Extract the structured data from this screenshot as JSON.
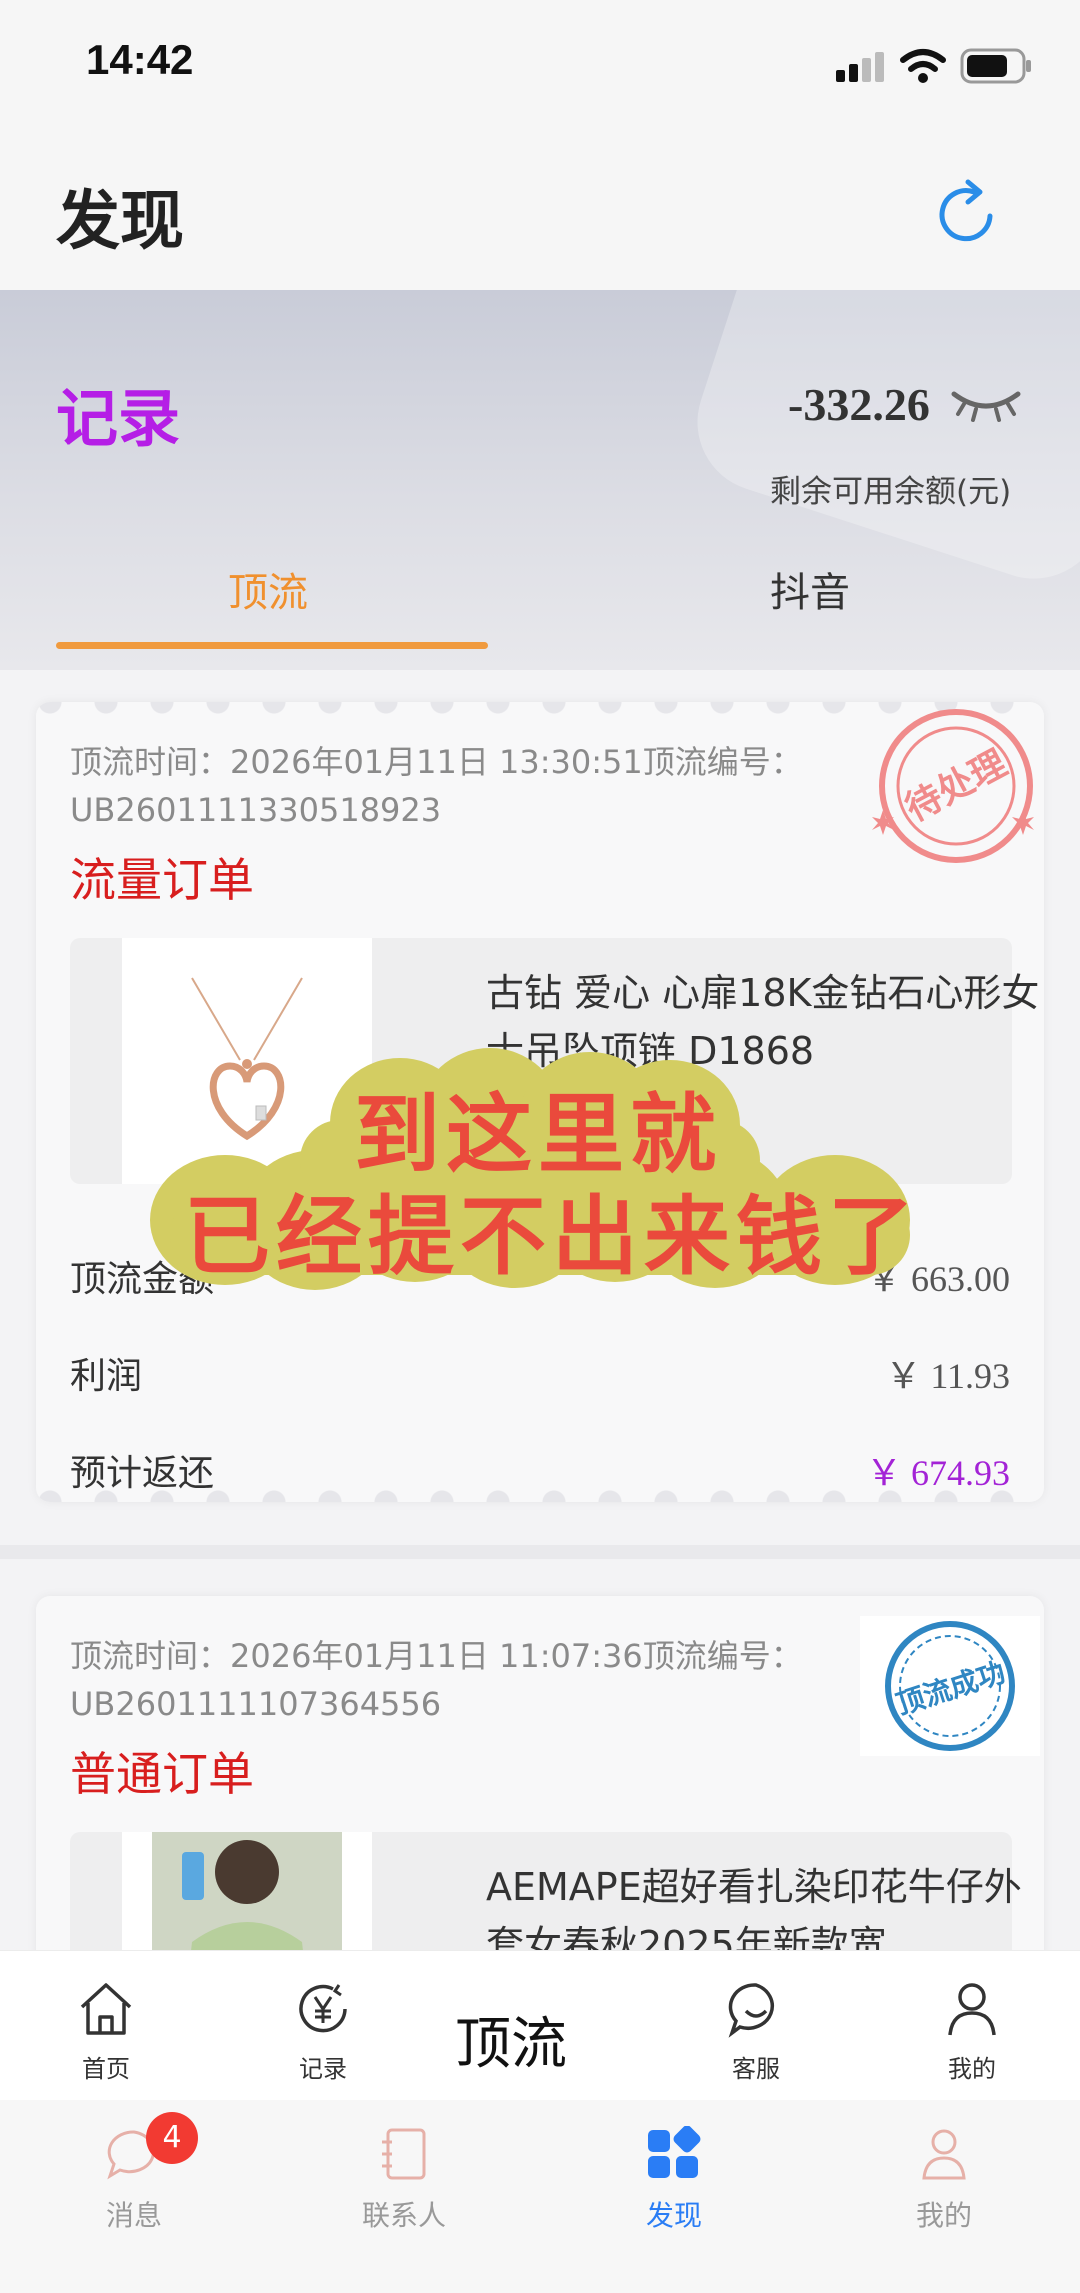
{
  "status_bar": {
    "time": "14:42"
  },
  "header": {
    "title": "发现",
    "refresh_icon": "refresh-icon"
  },
  "summary": {
    "title": "记录",
    "balance": "-332.26",
    "balance_label": "剩余可用余额(元)",
    "tabs": [
      {
        "label": "顶流",
        "active": true
      },
      {
        "label": "抖音",
        "active": false
      }
    ]
  },
  "orders": [
    {
      "meta_line1": "顶流时间：2026年01月11日 13:30:51顶流编号：",
      "meta_line2": "UB2601111330518923",
      "type": "流量订单",
      "stamp_text": "待处理",
      "product_title": "古钻 爱心 心扉18K金钻石心形女士吊坠项链 D1868",
      "rows": [
        {
          "label": "顶流金额",
          "value": "￥ 663.00"
        },
        {
          "label": "利润",
          "value": "￥ 11.93"
        },
        {
          "label": "预计返还",
          "value": "￥ 674.93"
        }
      ]
    },
    {
      "meta_line1": "顶流时间：2026年01月11日 11:07:36顶流编号：",
      "meta_line2": "UB2601111107364556",
      "type": "普通订单",
      "stamp_text": "顶流成功",
      "product_title": "AEMAPE超好看扎染印花牛仔外套女春秋2025年新款宽"
    }
  ],
  "overlay_caption": {
    "line1": "到这里就",
    "line2": "已经提不出来钱了"
  },
  "inner_tabbar": {
    "items": [
      {
        "label": "首页",
        "icon": "home-icon"
      },
      {
        "label": "记录",
        "icon": "yen-record-icon"
      },
      {
        "label": "客服",
        "icon": "chat-smile-icon"
      },
      {
        "label": "我的",
        "icon": "person-icon"
      }
    ],
    "center_label": "顶流"
  },
  "outer_tabbar": {
    "items": [
      {
        "label": "消息",
        "icon": "message-icon",
        "badge": "4"
      },
      {
        "label": "联系人",
        "icon": "contacts-icon"
      },
      {
        "label": "发现",
        "icon": "discover-icon",
        "active": true
      },
      {
        "label": "我的",
        "icon": "person-icon"
      }
    ]
  },
  "colors": {
    "accent_orange": "#f09a3e",
    "purple": "#b51ee6",
    "red": "#d81e1e",
    "blue": "#2a7df5"
  }
}
